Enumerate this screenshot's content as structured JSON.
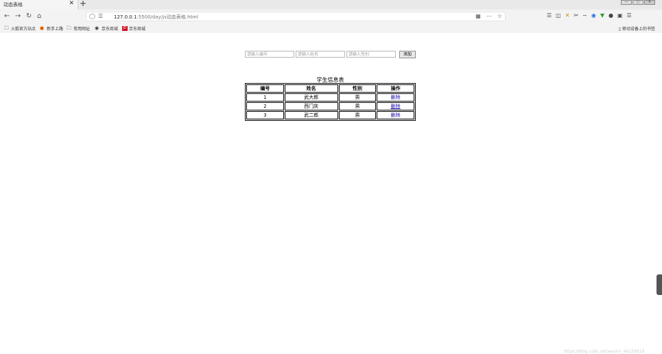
{
  "browser": {
    "tab_title": "动态表格",
    "tab_close": "✕",
    "new_tab": "+",
    "win_min": "—",
    "win_max": "▢",
    "win_close": "✕",
    "url_host": "127.0.0.1",
    "url_rest": ":5500/day/js动态表格.html",
    "bookmarks": [
      "火狐官方站点",
      "新手上路",
      "常用网址",
      "京东商城",
      "京东商城"
    ],
    "bookmark_jd_badge": "JD",
    "mobile_bookmarks": "移动设备上的书签"
  },
  "form": {
    "id_placeholder": "请输入编号",
    "name_placeholder": "请输入姓名",
    "gender_placeholder": "请输入性别",
    "add_label": "添加"
  },
  "table": {
    "caption": "学生信息表",
    "headers": [
      "编号",
      "姓名",
      "性别",
      "操作"
    ],
    "rows": [
      {
        "id": "1",
        "name": "武大郎",
        "gender": "男",
        "action": "删除"
      },
      {
        "id": "2",
        "name": "西门庆",
        "gender": "男",
        "action": "删除"
      },
      {
        "id": "3",
        "name": "武二郎",
        "gender": "男",
        "action": "删除"
      }
    ]
  },
  "watermark": "https://blog.csdn.net/weixin_46126919",
  "icons": {
    "back": "back-arrow-icon",
    "forward": "forward-arrow-icon",
    "reload": "reload-icon",
    "home": "home-icon"
  }
}
